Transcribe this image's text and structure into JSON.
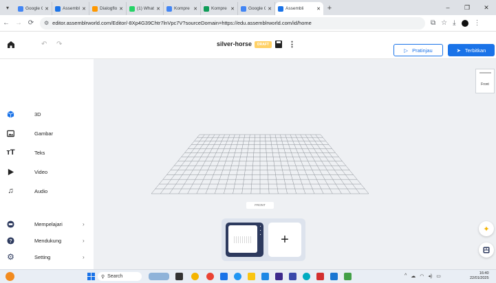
{
  "browser": {
    "tabs": [
      {
        "title": "Google Ge",
        "color": "#4285f4"
      },
      {
        "title": "Assembli",
        "color": "#1a73e8"
      },
      {
        "title": "Dialogflow",
        "color": "#ff9800"
      },
      {
        "title": "(1) Whats",
        "color": "#25d366"
      },
      {
        "title": "Kompre C",
        "color": "#4285f4"
      },
      {
        "title": "Kompre C",
        "color": "#0f9d58"
      },
      {
        "title": "Google Ge",
        "color": "#4285f4"
      },
      {
        "title": "Assembli",
        "color": "#1a73e8",
        "active": true
      }
    ],
    "url": "editor.assemblrworld.com/Editor/-8Xp4G39Chtr7lnVpc7V?sourceDomain=https://edu.assemblrworld.com/id/home"
  },
  "editor": {
    "project_title": "silver-horse",
    "draft_label": "DRAFT",
    "preview_label": "Pratinjau",
    "publish_label": "Terbitkan"
  },
  "sidebar": {
    "items": [
      {
        "label": "3D",
        "icon": "cube-icon"
      },
      {
        "label": "Gambar",
        "icon": "image-icon"
      },
      {
        "label": "Teks",
        "icon": "text-icon"
      },
      {
        "label": "Video",
        "icon": "play-icon"
      },
      {
        "label": "Audio",
        "icon": "music-icon"
      }
    ],
    "bottom_items": [
      {
        "label": "Mempelajari",
        "icon": "learn-icon"
      },
      {
        "label": "Mendukung",
        "icon": "help-icon"
      },
      {
        "label": "Setting",
        "icon": "gear-icon"
      }
    ]
  },
  "canvas": {
    "view_thumb_label": "Front",
    "front_label": "FRONT",
    "add_scene_symbol": "+"
  },
  "taskbar": {
    "search_placeholder": "Search",
    "time": "16:40",
    "date": "22/01/2025"
  },
  "colors": {
    "accent": "#1a73e8",
    "draft": "#ffd166",
    "scene_card": "#2d3a5e"
  }
}
